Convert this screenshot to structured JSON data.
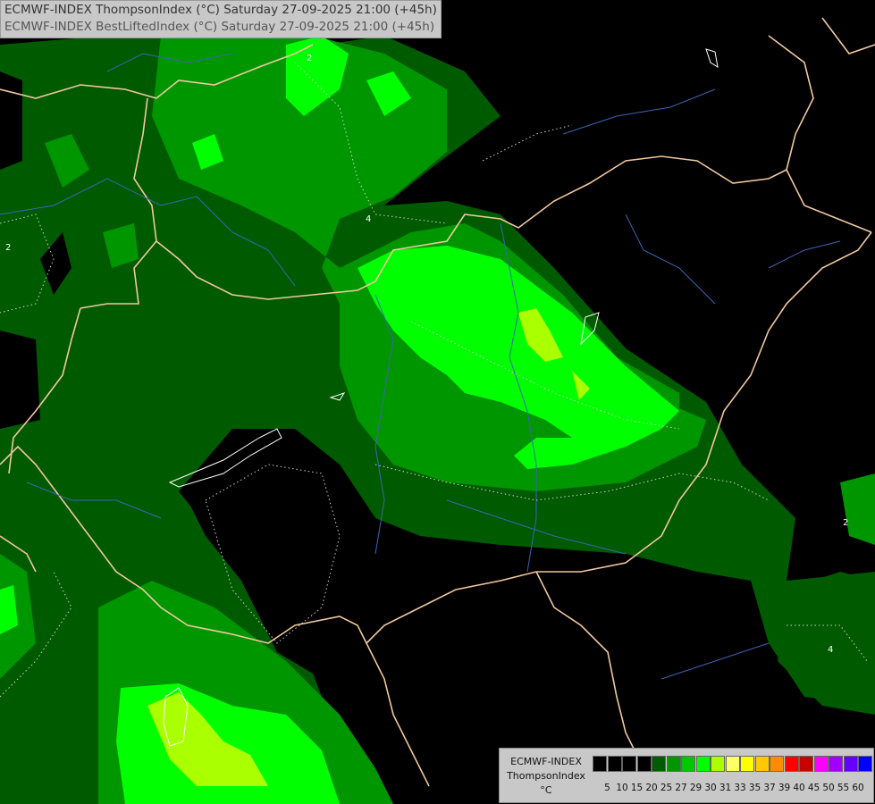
{
  "header": {
    "title_line1": "ECMWF-INDEX ThompsonIndex (°C) Saturday 27-09-2025 21:00 (+45h)",
    "title_line2": "ECMWF-INDEX BestLiftedIndex (°C) Saturday 27-09-2025 21:00 (+45h)"
  },
  "legend": {
    "model": "ECMWF-INDEX",
    "parameter": "ThompsonIndex",
    "unit": "°C",
    "levels": [
      "5",
      "10",
      "15",
      "20",
      "25",
      "27",
      "29",
      "30",
      "31",
      "33",
      "35",
      "37",
      "39",
      "40",
      "45",
      "50",
      "55",
      "60"
    ],
    "colors": [
      "#000000",
      "#000000",
      "#000000",
      "#000000",
      "#005a00",
      "#009600",
      "#00c800",
      "#00ff00",
      "#aaff00",
      "#ffff66",
      "#ffff00",
      "#ffc800",
      "#ff8c00",
      "#ff0000",
      "#c80000",
      "#ff00ff",
      "#a000ff",
      "#6400ff",
      "#0000ff"
    ]
  },
  "map": {
    "contour_labels": [
      "2",
      "4",
      "2",
      "2",
      "4"
    ]
  }
}
